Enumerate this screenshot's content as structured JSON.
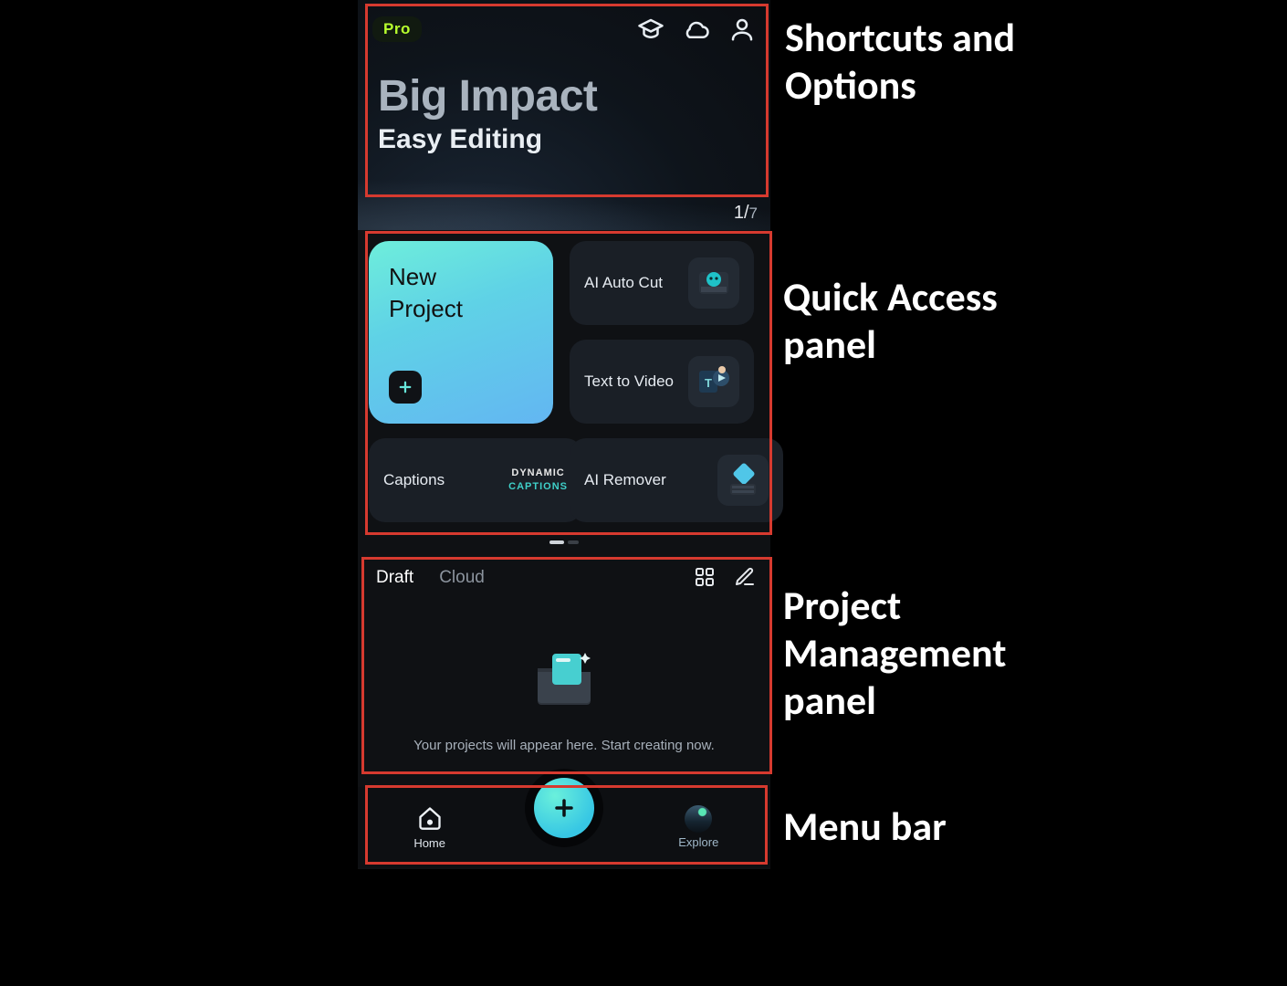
{
  "topbar": {
    "pro_label": "Pro"
  },
  "banner": {
    "headline": "Big Impact",
    "subhead": "Easy Editing",
    "page_current": "1",
    "page_sep": "/",
    "page_total": "7"
  },
  "quick_access": {
    "new_project_label": "New\nProject",
    "items": [
      {
        "label": "AI Auto Cut"
      },
      {
        "label": "Text to Video"
      },
      {
        "label": "Captions"
      },
      {
        "label": "AI Remover"
      }
    ],
    "captions_line1": "DYNAMIC",
    "captions_line2": "CAPTIONS"
  },
  "projects": {
    "tabs": {
      "draft": "Draft",
      "cloud": "Cloud"
    },
    "empty_message": "Your projects will appear here. Start creating now."
  },
  "menubar": {
    "home": "Home",
    "explore": "Explore"
  },
  "callouts": {
    "top": "Shortcuts and Options",
    "quick": "Quick Access panel",
    "projects": "Project Management panel",
    "menu": "Menu bar"
  }
}
